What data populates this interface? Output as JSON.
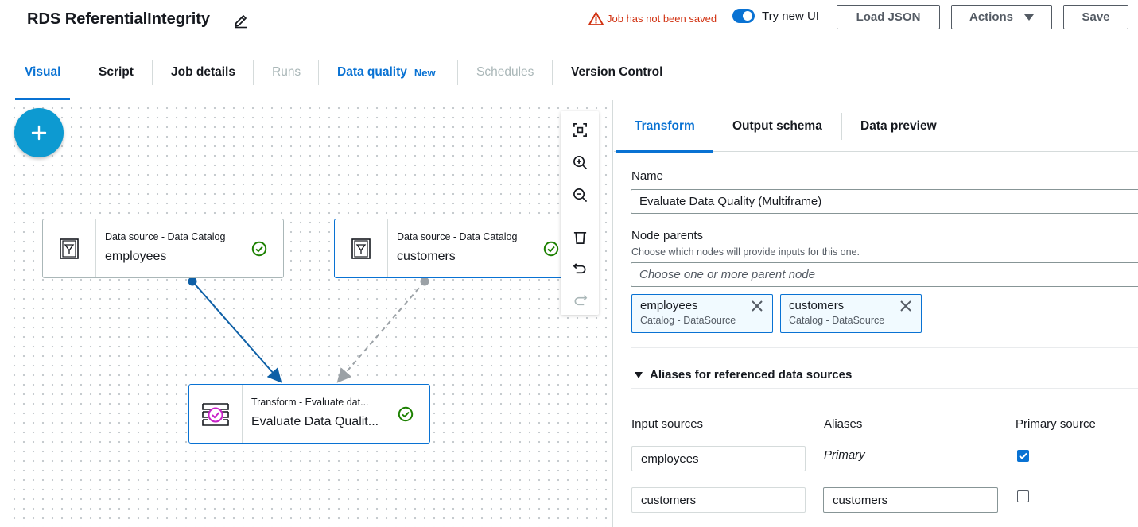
{
  "header": {
    "title": "RDS ReferentialIntegrity",
    "warning": "Job has not been saved",
    "toggle_label": "Try new UI",
    "load_json": "Load JSON",
    "actions": "Actions",
    "save": "Save"
  },
  "tabs": [
    {
      "label": "Visual",
      "state": "active"
    },
    {
      "label": "Script",
      "state": "normal"
    },
    {
      "label": "Job details",
      "state": "normal"
    },
    {
      "label": "Runs",
      "state": "disabled"
    },
    {
      "label": "Data quality",
      "badge": "New",
      "state": "link"
    },
    {
      "label": "Schedules",
      "state": "disabled"
    },
    {
      "label": "Version Control",
      "state": "normal"
    }
  ],
  "canvas": {
    "nodes": [
      {
        "type": "Data source - Data Catalog",
        "name": "employees",
        "status": "check-circle-icon"
      },
      {
        "type": "Data source - Data Catalog",
        "name": "customers",
        "status": "check-circle-icon"
      },
      {
        "type": "Transform - Evaluate dat...",
        "name": "Evaluate Data Qualit...",
        "status": "check-circle-icon"
      }
    ],
    "toolbar": [
      "fit-view-icon",
      "zoom-in-icon",
      "zoom-out-icon",
      "trash-icon",
      "undo-icon",
      "redo-icon"
    ]
  },
  "panel": {
    "tabs": [
      "Transform",
      "Output schema",
      "Data preview"
    ],
    "name_label": "Name",
    "name_value": "Evaluate Data Quality (Multiframe)",
    "parents_label": "Node parents",
    "parents_help": "Choose which nodes will provide inputs for this one.",
    "parents_placeholder": "Choose one or more parent node",
    "tokens": [
      {
        "name": "employees",
        "sub": "Catalog - DataSource"
      },
      {
        "name": "customers",
        "sub": "Catalog - DataSource"
      }
    ],
    "aliases_title": "Aliases for referenced data sources",
    "columns": [
      "Input sources",
      "Aliases",
      "Primary source"
    ],
    "rows": [
      {
        "source": "employees",
        "alias": "Primary",
        "primary": true
      },
      {
        "source": "customers",
        "alias": "customers",
        "primary": false
      }
    ]
  },
  "colors": {
    "accent": "#0972d3",
    "warning": "#d13212",
    "success": "#1d8102",
    "add_button": "#0d9ad1",
    "transform_icon": "#c923c9"
  }
}
